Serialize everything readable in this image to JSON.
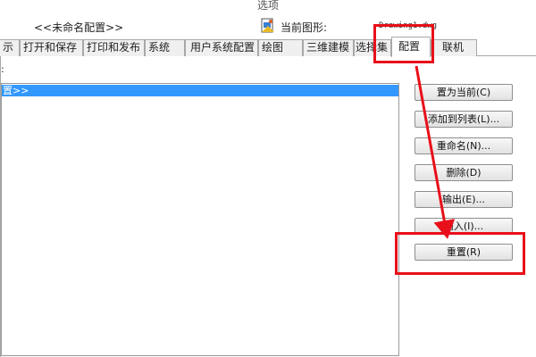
{
  "window": {
    "title": "选项"
  },
  "header": {
    "profile_name": "<<未命名配置>>",
    "current_drawing_label": "当前图形:",
    "current_drawing_value": "Drawing1.dwg"
  },
  "tabs": [
    {
      "label": "示",
      "active": false
    },
    {
      "label": "打开和保存",
      "active": false
    },
    {
      "label": "打印和发布",
      "active": false
    },
    {
      "label": "系统",
      "active": false
    },
    {
      "label": "用户系统配置",
      "active": false
    },
    {
      "label": "绘图",
      "active": false
    },
    {
      "label": "三维建模",
      "active": false
    },
    {
      "label": "选择集",
      "active": false
    },
    {
      "label": "配置",
      "active": true
    },
    {
      "label": "联机",
      "active": false
    }
  ],
  "profiles": {
    "list_label": ":",
    "items": [
      {
        "label": "置>>",
        "selected": true
      }
    ]
  },
  "buttons": {
    "set_current": "置为当前(C)",
    "add_to_list": "添加到列表(L)...",
    "rename": "重命名(N)...",
    "delete": "删除(D)",
    "export": "输出(E)...",
    "import": "输入(I)...",
    "reset": "重置(R)"
  },
  "annotation": {
    "color": "#e8101a"
  }
}
